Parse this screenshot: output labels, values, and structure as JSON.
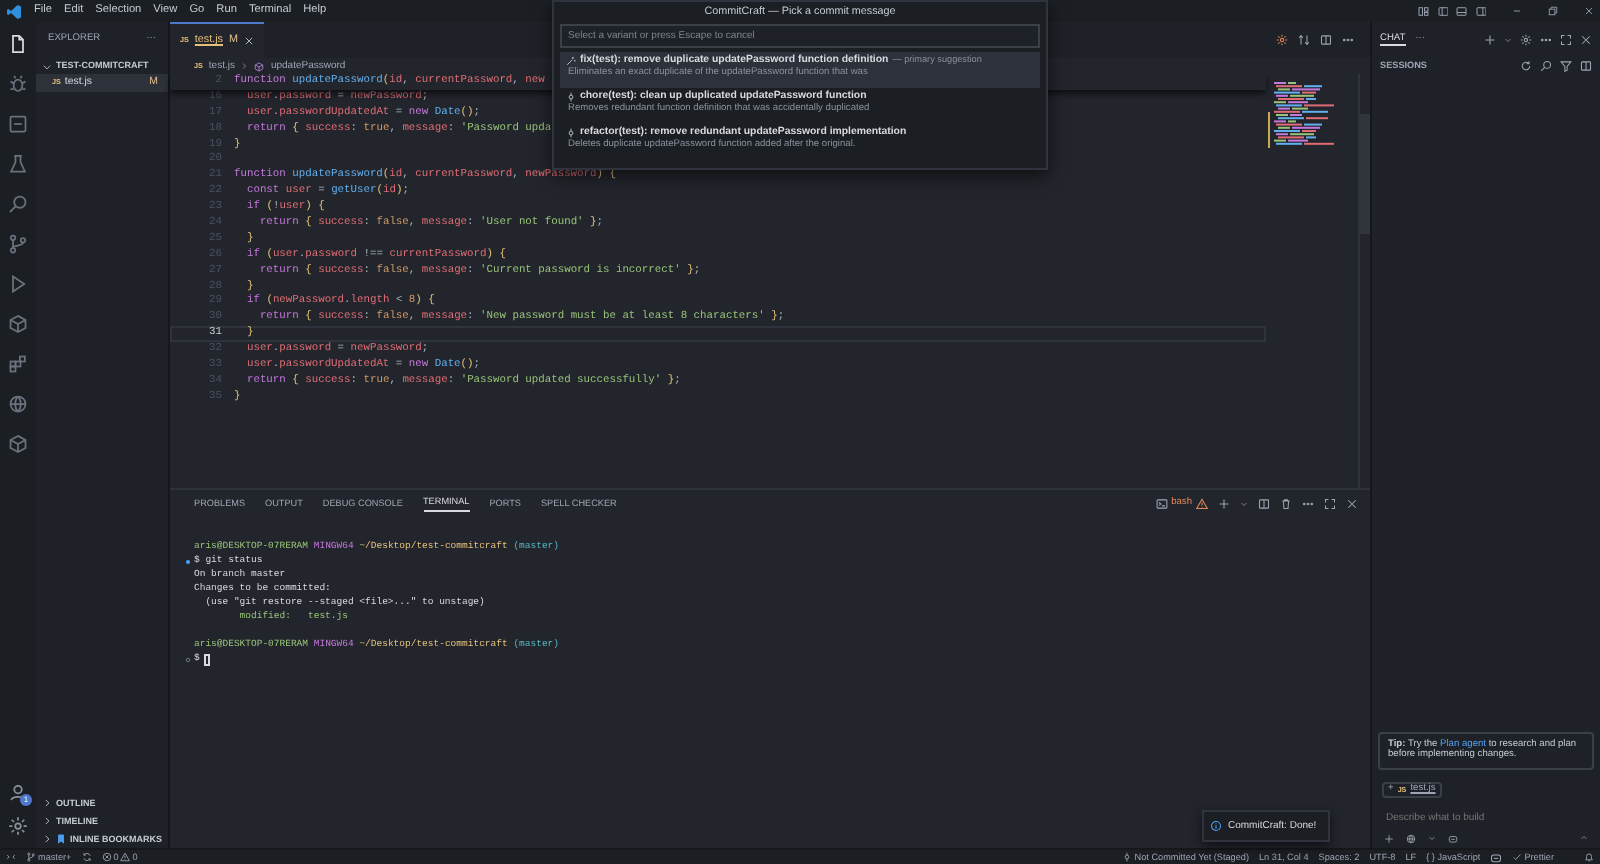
{
  "menu": [
    "File",
    "Edit",
    "Selection",
    "View",
    "Go",
    "Run",
    "Terminal",
    "Help"
  ],
  "quick_pick": {
    "title": "CommitCraft — Pick a commit message",
    "placeholder": "Select a variant or press Escape to cancel",
    "items": [
      {
        "kind": "primary",
        "label": "fix(test): remove duplicate updatePassword function definition",
        "description": "— primary suggestion",
        "detail": "Eliminates an exact duplicate of the updatePassword function that was",
        "selected": true
      },
      {
        "kind": "alternative",
        "label": "chore(test): clean up duplicated updatePassword function",
        "detail": "Removes redundant function definition that was accidentally duplicated",
        "selected": false
      },
      {
        "kind": "alternative",
        "label": "refactor(test): remove redundant updatePassword implementation",
        "detail": "Deletes duplicate updatePassword function added after the original.",
        "selected": false
      }
    ]
  },
  "activity_bar": {
    "items": [
      {
        "selected": true
      },
      {
        "selected": false
      },
      {
        "selected": false
      },
      {
        "selected": false
      },
      {
        "selected": false
      },
      {
        "selected": false
      },
      {
        "selected": false
      },
      {
        "selected": false
      },
      {
        "selected": false
      },
      {
        "selected": false
      },
      {
        "selected": false
      }
    ],
    "account_badge": "1"
  },
  "explorer": {
    "title": "EXPLORER",
    "more": "···",
    "folder": "TEST-COMMITCRAFT",
    "files": [
      {
        "icon_text": "JS",
        "name": "test.js",
        "badge": "M",
        "selected": true
      }
    ],
    "sections": [
      "OUTLINE",
      "TIMELINE",
      "INLINE BOOKMARKS"
    ]
  },
  "editor": {
    "tabs": [
      {
        "icon_text": "JS",
        "name": "test.js",
        "badge": "M",
        "selected": true
      }
    ],
    "breadcrumb": {
      "icon_text": "JS",
      "file": "test.js",
      "symbol": "updatePassword"
    },
    "sticky_lines": [
      {
        "number": "2",
        "tokens": [
          {
            "kind": "kw",
            "text": "function "
          },
          {
            "kind": "fn",
            "text": "updatePassword"
          },
          {
            "kind": "br",
            "text": "("
          },
          {
            "kind": "v",
            "text": "id"
          },
          {
            "kind": "p",
            "text": ", "
          },
          {
            "kind": "v",
            "text": "currentPassword"
          },
          {
            "kind": "p",
            "text": ", "
          },
          {
            "kind": "v",
            "text": "new"
          }
        ]
      }
    ],
    "lines": [
      {
        "number": "16",
        "current": false,
        "tokens": [
          {
            "kind": "v",
            "text": "  user"
          },
          {
            "kind": "p",
            "text": "."
          },
          {
            "kind": "v",
            "text": "password"
          },
          {
            "kind": "p",
            "text": " = "
          },
          {
            "kind": "v",
            "text": "newPassword"
          },
          {
            "kind": "p",
            "text": ";"
          }
        ]
      },
      {
        "number": "17",
        "current": false,
        "tokens": [
          {
            "kind": "v",
            "text": "  user"
          },
          {
            "kind": "p",
            "text": "."
          },
          {
            "kind": "v",
            "text": "passwordUpdatedAt"
          },
          {
            "kind": "p",
            "text": " = "
          },
          {
            "kind": "kw",
            "text": "new "
          },
          {
            "kind": "fn",
            "text": "Date"
          },
          {
            "kind": "br",
            "text": "()"
          },
          {
            "kind": "p",
            "text": ";"
          }
        ]
      },
      {
        "number": "18",
        "current": false,
        "tokens": [
          {
            "kind": "kw",
            "text": "  return "
          },
          {
            "kind": "br",
            "text": "{ "
          },
          {
            "kind": "v",
            "text": "success"
          },
          {
            "kind": "p",
            "text": ": "
          },
          {
            "kind": "b",
            "text": "true"
          },
          {
            "kind": "p",
            "text": ", "
          },
          {
            "kind": "v",
            "text": "message"
          },
          {
            "kind": "p",
            "text": ": "
          },
          {
            "kind": "s",
            "text": "'Password upda"
          }
        ]
      },
      {
        "number": "19",
        "current": false,
        "tokens": [
          {
            "kind": "br",
            "text": "}"
          }
        ]
      },
      {
        "number": "20",
        "current": false
      },
      {
        "number": "21",
        "current": false,
        "tokens": [
          {
            "kind": "kw",
            "text": "function "
          },
          {
            "kind": "fn",
            "text": "updatePassword"
          },
          {
            "kind": "br",
            "text": "("
          },
          {
            "kind": "v",
            "text": "id"
          },
          {
            "kind": "p",
            "text": ", "
          },
          {
            "kind": "v",
            "text": "currentPassword"
          },
          {
            "kind": "p",
            "text": ", "
          },
          {
            "kind": "v",
            "text": "newPassword"
          },
          {
            "kind": "br",
            "text": ") {"
          }
        ]
      },
      {
        "number": "22",
        "current": false,
        "tokens": [
          {
            "kind": "kw",
            "text": "  const "
          },
          {
            "kind": "v",
            "text": "user"
          },
          {
            "kind": "p",
            "text": " = "
          },
          {
            "kind": "fn",
            "text": "getUser"
          },
          {
            "kind": "br",
            "text": "("
          },
          {
            "kind": "v",
            "text": "id"
          },
          {
            "kind": "br",
            "text": ")"
          },
          {
            "kind": "p",
            "text": ";"
          }
        ]
      },
      {
        "number": "23",
        "current": false,
        "tokens": [
          {
            "kind": "kw",
            "text": "  if "
          },
          {
            "kind": "br",
            "text": "("
          },
          {
            "kind": "p",
            "text": "!"
          },
          {
            "kind": "v",
            "text": "user"
          },
          {
            "kind": "br",
            "text": ") {"
          }
        ]
      },
      {
        "number": "24",
        "current": false,
        "tokens": [
          {
            "kind": "kw",
            "text": "    return "
          },
          {
            "kind": "br",
            "text": "{ "
          },
          {
            "kind": "v",
            "text": "success"
          },
          {
            "kind": "p",
            "text": ": "
          },
          {
            "kind": "b",
            "text": "false"
          },
          {
            "kind": "p",
            "text": ", "
          },
          {
            "kind": "v",
            "text": "message"
          },
          {
            "kind": "p",
            "text": ": "
          },
          {
            "kind": "s",
            "text": "'User not found'"
          },
          {
            "kind": "br",
            "text": " }"
          },
          {
            "kind": "p",
            "text": ";"
          }
        ]
      },
      {
        "number": "25",
        "current": false,
        "tokens": [
          {
            "kind": "br",
            "text": "  }"
          }
        ]
      },
      {
        "number": "26",
        "current": false,
        "tokens": [
          {
            "kind": "kw",
            "text": "  if "
          },
          {
            "kind": "br",
            "text": "("
          },
          {
            "kind": "v",
            "text": "user"
          },
          {
            "kind": "p",
            "text": "."
          },
          {
            "kind": "v",
            "text": "password"
          },
          {
            "kind": "p",
            "text": " !== "
          },
          {
            "kind": "v",
            "text": "currentPassword"
          },
          {
            "kind": "br",
            "text": ") {"
          }
        ]
      },
      {
        "number": "27",
        "current": false,
        "tokens": [
          {
            "kind": "kw",
            "text": "    return "
          },
          {
            "kind": "br",
            "text": "{ "
          },
          {
            "kind": "v",
            "text": "success"
          },
          {
            "kind": "p",
            "text": ": "
          },
          {
            "kind": "b",
            "text": "false"
          },
          {
            "kind": "p",
            "text": ", "
          },
          {
            "kind": "v",
            "text": "message"
          },
          {
            "kind": "p",
            "text": ": "
          },
          {
            "kind": "s",
            "text": "'Current password is incorrect'"
          },
          {
            "kind": "br",
            "text": " }"
          },
          {
            "kind": "p",
            "text": ";"
          }
        ]
      },
      {
        "number": "28",
        "current": false,
        "tokens": [
          {
            "kind": "br",
            "text": "  }"
          }
        ]
      },
      {
        "number": "29",
        "current": false,
        "tokens": [
          {
            "kind": "kw",
            "text": "  if "
          },
          {
            "kind": "br",
            "text": "("
          },
          {
            "kind": "v",
            "text": "newPassword"
          },
          {
            "kind": "p",
            "text": "."
          },
          {
            "kind": "v",
            "text": "length"
          },
          {
            "kind": "p",
            "text": " < "
          },
          {
            "kind": "b",
            "text": "8"
          },
          {
            "kind": "br",
            "text": ") {"
          }
        ]
      },
      {
        "number": "30",
        "current": false,
        "tokens": [
          {
            "kind": "kw",
            "text": "    return "
          },
          {
            "kind": "br",
            "text": "{ "
          },
          {
            "kind": "v",
            "text": "success"
          },
          {
            "kind": "p",
            "text": ": "
          },
          {
            "kind": "b",
            "text": "false"
          },
          {
            "kind": "p",
            "text": ", "
          },
          {
            "kind": "v",
            "text": "message"
          },
          {
            "kind": "p",
            "text": ": "
          },
          {
            "kind": "s",
            "text": "'New password must be at least 8 characters'"
          },
          {
            "kind": "br",
            "text": " }"
          },
          {
            "kind": "p",
            "text": ";"
          }
        ]
      },
      {
        "number": "31",
        "current": true,
        "tokens": [
          {
            "kind": "br",
            "text": "  }"
          }
        ]
      },
      {
        "number": "32",
        "current": false,
        "tokens": [
          {
            "kind": "v",
            "text": "  user"
          },
          {
            "kind": "p",
            "text": "."
          },
          {
            "kind": "v",
            "text": "password"
          },
          {
            "kind": "p",
            "text": " = "
          },
          {
            "kind": "v",
            "text": "newPassword"
          },
          {
            "kind": "p",
            "text": ";"
          }
        ]
      },
      {
        "number": "33",
        "current": false,
        "tokens": [
          {
            "kind": "v",
            "text": "  user"
          },
          {
            "kind": "p",
            "text": "."
          },
          {
            "kind": "v",
            "text": "passwordUpdatedAt"
          },
          {
            "kind": "p",
            "text": " = "
          },
          {
            "kind": "kw",
            "text": "new "
          },
          {
            "kind": "fn",
            "text": "Date"
          },
          {
            "kind": "br",
            "text": "()"
          },
          {
            "kind": "p",
            "text": ";"
          }
        ]
      },
      {
        "number": "34",
        "current": false,
        "tokens": [
          {
            "kind": "kw",
            "text": "  return "
          },
          {
            "kind": "br",
            "text": "{ "
          },
          {
            "kind": "v",
            "text": "success"
          },
          {
            "kind": "p",
            "text": ": "
          },
          {
            "kind": "b",
            "text": "true"
          },
          {
            "kind": "p",
            "text": ", "
          },
          {
            "kind": "v",
            "text": "message"
          },
          {
            "kind": "p",
            "text": ": "
          },
          {
            "kind": "s",
            "text": "'Password updated successfully'"
          },
          {
            "kind": "br",
            "text": " }"
          },
          {
            "kind": "p",
            "text": ";"
          }
        ]
      },
      {
        "number": "35",
        "current": false,
        "tokens": [
          {
            "kind": "br",
            "text": "}"
          }
        ]
      }
    ]
  },
  "panel": {
    "tabs": [
      {
        "label": "PROBLEMS",
        "selected": false
      },
      {
        "label": "OUTPUT",
        "selected": false
      },
      {
        "label": "DEBUG CONSOLE",
        "selected": false
      },
      {
        "label": "TERMINAL",
        "selected": true
      },
      {
        "label": "PORTS",
        "selected": false
      },
      {
        "label": "SPELL CHECKER",
        "selected": false
      }
    ],
    "terminal_name": "bash",
    "cursor": true,
    "lines": [
      {
        "command": false,
        "spans": [
          {
            "kind": "user",
            "text": "aris@DESKTOP-07RERAM"
          },
          {
            "kind": "host",
            "text": "MINGW64"
          },
          {
            "kind": "path",
            "text": "~/Desktop/test-commitcraft"
          },
          {
            "kind": "branch",
            "text": "(master)"
          }
        ]
      },
      {
        "command": true,
        "finished": true,
        "spans": [
          {
            "kind": "plain",
            "text": "$ git status"
          }
        ]
      },
      {
        "command": false,
        "spans": [
          {
            "kind": "plain",
            "text": "On branch master"
          }
        ]
      },
      {
        "command": false,
        "spans": [
          {
            "kind": "plain",
            "text": "Changes to be committed:"
          }
        ]
      },
      {
        "command": false,
        "spans": [
          {
            "kind": "plain",
            "text": "  (use \"git restore --staged <file>...\" to unstage)"
          }
        ]
      },
      {
        "command": false,
        "spans": [
          {
            "kind": "modified",
            "text": "        modified:   test.js"
          }
        ]
      },
      {
        "command": false,
        "spans": [
          {
            "kind": "user",
            "text": "aris@DESKTOP-07RERAM"
          },
          {
            "kind": "host",
            "text": "MINGW64"
          },
          {
            "kind": "path",
            "text": "~/Desktop/test-commitcraft"
          },
          {
            "kind": "branch",
            "text": "(master)"
          }
        ]
      },
      {
        "command": true,
        "finished": false,
        "spans": [
          {
            "kind": "plain",
            "text": "$"
          }
        ]
      }
    ]
  },
  "chat": {
    "title": "CHAT",
    "more": "···",
    "sessions": "SESSIONS",
    "tip": "**Tip:** Try the ",
    "tip_link": "Plan agent",
    "tip_rest": " to research and plan before implementing changes.",
    "context": {
      "add": "+",
      "icon_text": "JS",
      "file": "test.js"
    },
    "input_placeholder": "Describe what to build"
  },
  "notification": "CommitCraft: Done!",
  "status_bar": {
    "branch": "master+",
    "errors": "0",
    "warnings": "0",
    "blame": "Not Committed Yet (Staged)",
    "position": "Ln 31, Col 4",
    "indent": "Spaces: 2",
    "encoding": "UTF-8",
    "eol": "LF",
    "language": "{ } JavaScript",
    "formatter": "Prettier"
  }
}
